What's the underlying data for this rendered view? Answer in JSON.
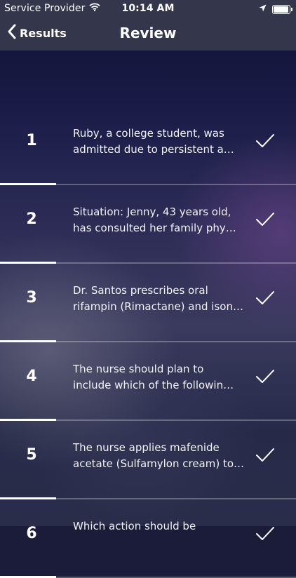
{
  "status_bar": {
    "carrier": "Service Provider",
    "time": "10:14 AM",
    "battery_level": 0.95
  },
  "nav": {
    "back_label": "Results",
    "title": "Review"
  },
  "items": [
    {
      "number": "1",
      "line1": "Ruby, a college student, was",
      "line2": "admitted due to persistent a…",
      "progress": 0.19
    },
    {
      "number": "2",
      "line1": "Situation: Jenny, 43 years old,",
      "line2": "has consulted her  family phy…",
      "progress": 0.19
    },
    {
      "number": "3",
      "line1": "Dr. Santos prescribes oral",
      "line2": "rifampin (Rimactane) and ison…",
      "progress": 0.19
    },
    {
      "number": "4",
      "line1": "The nurse should plan to",
      "line2": "include which of the followin…",
      "progress": 0.19
    },
    {
      "number": "5",
      "line1": "The nurse applies mafenide",
      "line2": "acetate (Sulfamylon cream) to…",
      "progress": 0.19
    },
    {
      "number": "6",
      "line1": "Which action  should  be",
      "line2": "",
      "progress": 0.19
    }
  ],
  "icons": {
    "check": "checkmark-icon",
    "back": "chevron-left-icon",
    "wifi": "wifi-icon",
    "location": "location-arrow-icon",
    "battery": "battery-icon"
  }
}
